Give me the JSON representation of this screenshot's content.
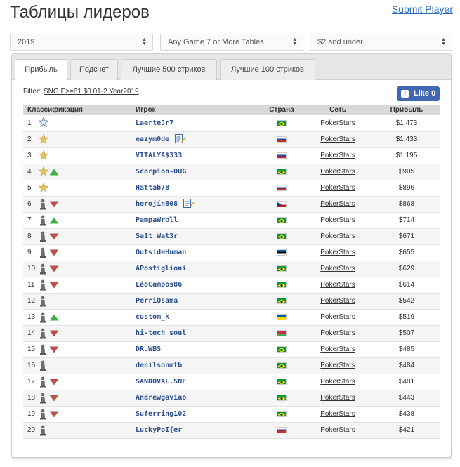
{
  "header": {
    "title": "Таблицы лидеров",
    "submit_label": "Submit Player"
  },
  "filters": {
    "year": "2019",
    "games": "Any Game 7 or More Tables",
    "stakes": "$2 and under"
  },
  "tabs": [
    {
      "label": "Прибыль",
      "active": true
    },
    {
      "label": "Подсчет",
      "active": false
    },
    {
      "label": "Лучшие 500 стриков",
      "active": false
    },
    {
      "label": "Лучшие 100 стриков",
      "active": false
    }
  ],
  "filter_line": {
    "label": "Filter:",
    "value": "SNG E>=61 $0.01-2 Year2019"
  },
  "like": {
    "label": "Like 0",
    "icon": "facebook-icon"
  },
  "table": {
    "headers": {
      "rank": "Классификация",
      "player": "Игрок",
      "country": "Страна",
      "network": "Сеть",
      "prize": "Прибыль"
    },
    "rows": [
      {
        "rank": "1",
        "badge": "star-outline-icon",
        "trend": "none",
        "player": "LaerteJr7",
        "note": false,
        "flag": "brazil",
        "network": "PokerStars",
        "prize": "$1,473"
      },
      {
        "rank": "2",
        "badge": "star-icon",
        "trend": "none",
        "player": "eazym0de",
        "note": true,
        "flag": "russia",
        "network": "PokerStars",
        "prize": "$1,433"
      },
      {
        "rank": "3",
        "badge": "star-icon",
        "trend": "none",
        "player": "VITALYA$333",
        "note": false,
        "flag": "russia",
        "network": "PokerStars",
        "prize": "$1,195"
      },
      {
        "rank": "4",
        "badge": "star-icon",
        "trend": "up",
        "player": "Scorpion-DUG",
        "note": false,
        "flag": "brazil",
        "network": "PokerStars",
        "prize": "$905"
      },
      {
        "rank": "5",
        "badge": "star-icon",
        "trend": "none",
        "player": "Hattab78",
        "note": false,
        "flag": "russia",
        "network": "PokerStars",
        "prize": "$896"
      },
      {
        "rank": "6",
        "badge": "pawn-icon",
        "trend": "down",
        "player": "herojín808",
        "note": true,
        "flag": "czech",
        "network": "PokerStars",
        "prize": "$868"
      },
      {
        "rank": "7",
        "badge": "pawn-icon",
        "trend": "up",
        "player": "PampaWroll",
        "note": false,
        "flag": "brazil",
        "network": "PokerStars",
        "prize": "$714"
      },
      {
        "rank": "8",
        "badge": "pawn-icon",
        "trend": "down",
        "player": "Sa1t Wat3r",
        "note": false,
        "flag": "brazil",
        "network": "PokerStars",
        "prize": "$671"
      },
      {
        "rank": "9",
        "badge": "pawn-icon",
        "trend": "down",
        "player": "OutsideHuman",
        "note": false,
        "flag": "estonia",
        "network": "PokerStars",
        "prize": "$655"
      },
      {
        "rank": "10",
        "badge": "pawn-icon",
        "trend": "down",
        "player": "APostiglioni",
        "note": false,
        "flag": "brazil",
        "network": "PokerStars",
        "prize": "$629"
      },
      {
        "rank": "11",
        "badge": "pawn-icon",
        "trend": "down",
        "player": "LéoCampos86",
        "note": false,
        "flag": "brazil",
        "network": "PokerStars",
        "prize": "$614"
      },
      {
        "rank": "12",
        "badge": "pawn-icon",
        "trend": "none",
        "player": "PerriOsama",
        "note": false,
        "flag": "brazil",
        "network": "PokerStars",
        "prize": "$542"
      },
      {
        "rank": "13",
        "badge": "pawn-icon",
        "trend": "up",
        "player": "custom_k",
        "note": false,
        "flag": "ukraine",
        "network": "PokerStars",
        "prize": "$519"
      },
      {
        "rank": "14",
        "badge": "pawn-icon",
        "trend": "down",
        "player": "hi-tech soul",
        "note": false,
        "flag": "belarus",
        "network": "PokerStars",
        "prize": "$507"
      },
      {
        "rank": "15",
        "badge": "pawn-icon",
        "trend": "down",
        "player": "DR.WBS",
        "note": false,
        "flag": "brazil",
        "network": "PokerStars",
        "prize": "$485"
      },
      {
        "rank": "16",
        "badge": "pawn-icon",
        "trend": "none",
        "player": "denilsonmtb",
        "note": false,
        "flag": "brazil",
        "network": "PokerStars",
        "prize": "$484"
      },
      {
        "rank": "17",
        "badge": "pawn-icon",
        "trend": "down",
        "player": "SANDOVAL.SNF",
        "note": false,
        "flag": "brazil",
        "network": "PokerStars",
        "prize": "$481"
      },
      {
        "rank": "18",
        "badge": "pawn-icon",
        "trend": "down",
        "player": "Andrewgaviao",
        "note": false,
        "flag": "brazil",
        "network": "PokerStars",
        "prize": "$443"
      },
      {
        "rank": "19",
        "badge": "pawn-icon",
        "trend": "down",
        "player": "Suferring102",
        "note": false,
        "flag": "brazil",
        "network": "PokerStars",
        "prize": "$438"
      },
      {
        "rank": "20",
        "badge": "pawn-icon",
        "trend": "none",
        "player": "LuckyPoI{er",
        "note": false,
        "flag": "russia",
        "network": "PokerStars",
        "prize": "$421"
      }
    ]
  },
  "colors": {
    "link": "#2a6ebb",
    "player": "#2c4f8c",
    "up": "#3fae49",
    "down": "#b5524a",
    "facebook": "#4267b2"
  }
}
